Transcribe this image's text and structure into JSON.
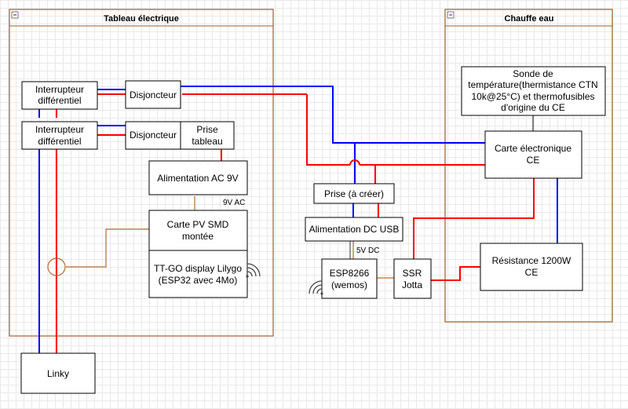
{
  "containers": {
    "tableau": {
      "title": "Tableau électrique",
      "collapse_glyph": "−"
    },
    "chauffe_eau": {
      "title": "Chauffe eau",
      "collapse_glyph": "−"
    }
  },
  "boxes": {
    "interrupteur1": [
      "Interrupteur",
      "différentiel"
    ],
    "interrupteur2": [
      "Interrupteur",
      "différentiel"
    ],
    "disjoncteur1": [
      "Disjoncteur"
    ],
    "disjoncteur2": [
      "Disjoncteur"
    ],
    "prise_tableau": [
      "Prise",
      "tableau"
    ],
    "alim_ac": [
      "Alimentation AC 9V"
    ],
    "carte_pv": [
      "Carte PV SMD",
      "montée"
    ],
    "ttgo": [
      "TT-GO display Lilygo",
      "(ESP32 avec 4Mo)"
    ],
    "linky": [
      "Linky"
    ],
    "prise_creer": [
      "Prise (à créer)"
    ],
    "alim_dc": [
      "Alimentation DC USB"
    ],
    "esp8266": [
      "ESP8266",
      "(wemos)"
    ],
    "ssr": [
      "SSR",
      "Jotta"
    ],
    "sonde": [
      "Sonde de",
      "température(thermistance CTN",
      "10k@25°C) et thermofusibles",
      "d'origine du CE"
    ],
    "carte_ce": [
      "Carte électronique",
      "CE"
    ],
    "resistance": [
      "Résistance 1200W",
      "CE"
    ]
  },
  "labels": {
    "ac9v": "9V AC",
    "dc5v": "5V DC"
  },
  "colors": {
    "wire_blue": "#0000ff",
    "wire_red": "#ff0000",
    "wire_brown": "#b07030",
    "container_border": "#9a5f2a",
    "box_border": "#000000"
  },
  "icons": {
    "wifi_ttgo": "wifi-icon",
    "wifi_esp": "wifi-icon",
    "current_clamp": "current-sensor-icon"
  }
}
